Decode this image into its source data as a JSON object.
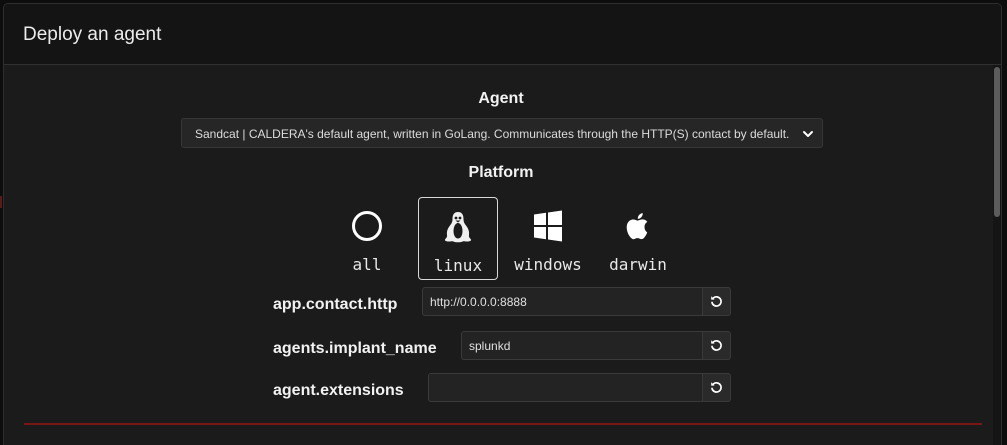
{
  "modal": {
    "title": "Deploy an agent"
  },
  "agent_section": {
    "label": "Agent",
    "selected_agent": "Sandcat | CALDERA's default agent, written in GoLang. Communicates through the HTTP(S) contact by default."
  },
  "platform_section": {
    "label": "Platform",
    "selected": "linux",
    "options": [
      {
        "label": "all",
        "icon": "circle-icon"
      },
      {
        "label": "linux",
        "icon": "linux-tux-icon"
      },
      {
        "label": "windows",
        "icon": "windows-icon"
      },
      {
        "label": "darwin",
        "icon": "apple-icon"
      }
    ]
  },
  "fields": [
    {
      "label": "app.contact.http",
      "value": "http://0.0.0.0:8888"
    },
    {
      "label": "agents.implant_name",
      "value": "splunkd"
    },
    {
      "label": "agent.extensions",
      "value": ""
    }
  ],
  "colors": {
    "modal_background": "#1b1b1b",
    "header_background": "#141414",
    "divider_accent": "#7a1616",
    "selected_border": "#d8d8d8"
  }
}
